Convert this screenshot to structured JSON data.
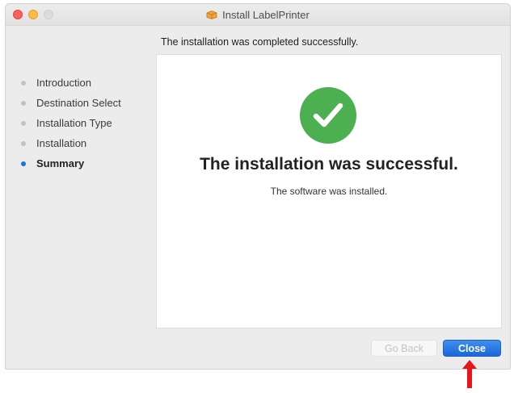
{
  "window": {
    "title": "Install LabelPrinter",
    "subtitle": "The installation was completed successfully."
  },
  "sidebar": {
    "steps": [
      {
        "label": "Introduction",
        "active": false
      },
      {
        "label": "Destination Select",
        "active": false
      },
      {
        "label": "Installation Type",
        "active": false
      },
      {
        "label": "Installation",
        "active": false
      },
      {
        "label": "Summary",
        "active": true
      }
    ]
  },
  "content": {
    "headline": "The installation was successful.",
    "message": "The software was installed."
  },
  "buttons": {
    "go_back": "Go Back",
    "close": "Close"
  },
  "colors": {
    "success_green": "#4caf50",
    "accent_blue": "#1c6fe0",
    "annotation_arrow": "#e8161b"
  },
  "icons": [
    "package-icon",
    "checkmark-icon",
    "annotation-arrow-icon"
  ]
}
